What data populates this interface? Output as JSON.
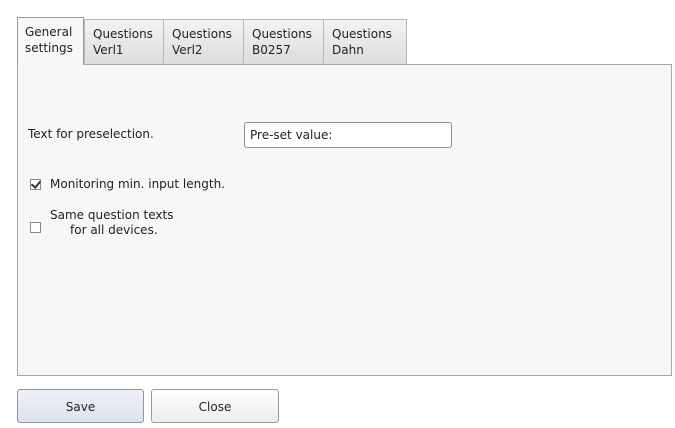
{
  "tabs": [
    {
      "line1": "General",
      "line2": "settings",
      "active": true
    },
    {
      "line1": "Questions",
      "line2": "Verl1",
      "active": false
    },
    {
      "line1": "Questions",
      "line2": "Verl2",
      "active": false
    },
    {
      "line1": "Questions",
      "line2": "B0257",
      "active": false
    },
    {
      "line1": "Questions",
      "line2": "Dahn",
      "active": false
    }
  ],
  "general": {
    "preselection_label": "Text for preselection.",
    "preselection_value": "Pre-set value:",
    "monitoring_label": "Monitoring min. input length.",
    "monitoring_checked": true,
    "same_texts_line1": "Same question texts",
    "same_texts_line2": "for all devices.",
    "same_texts_checked": false
  },
  "buttons": {
    "save_label": "Save",
    "close_label": "Close"
  }
}
